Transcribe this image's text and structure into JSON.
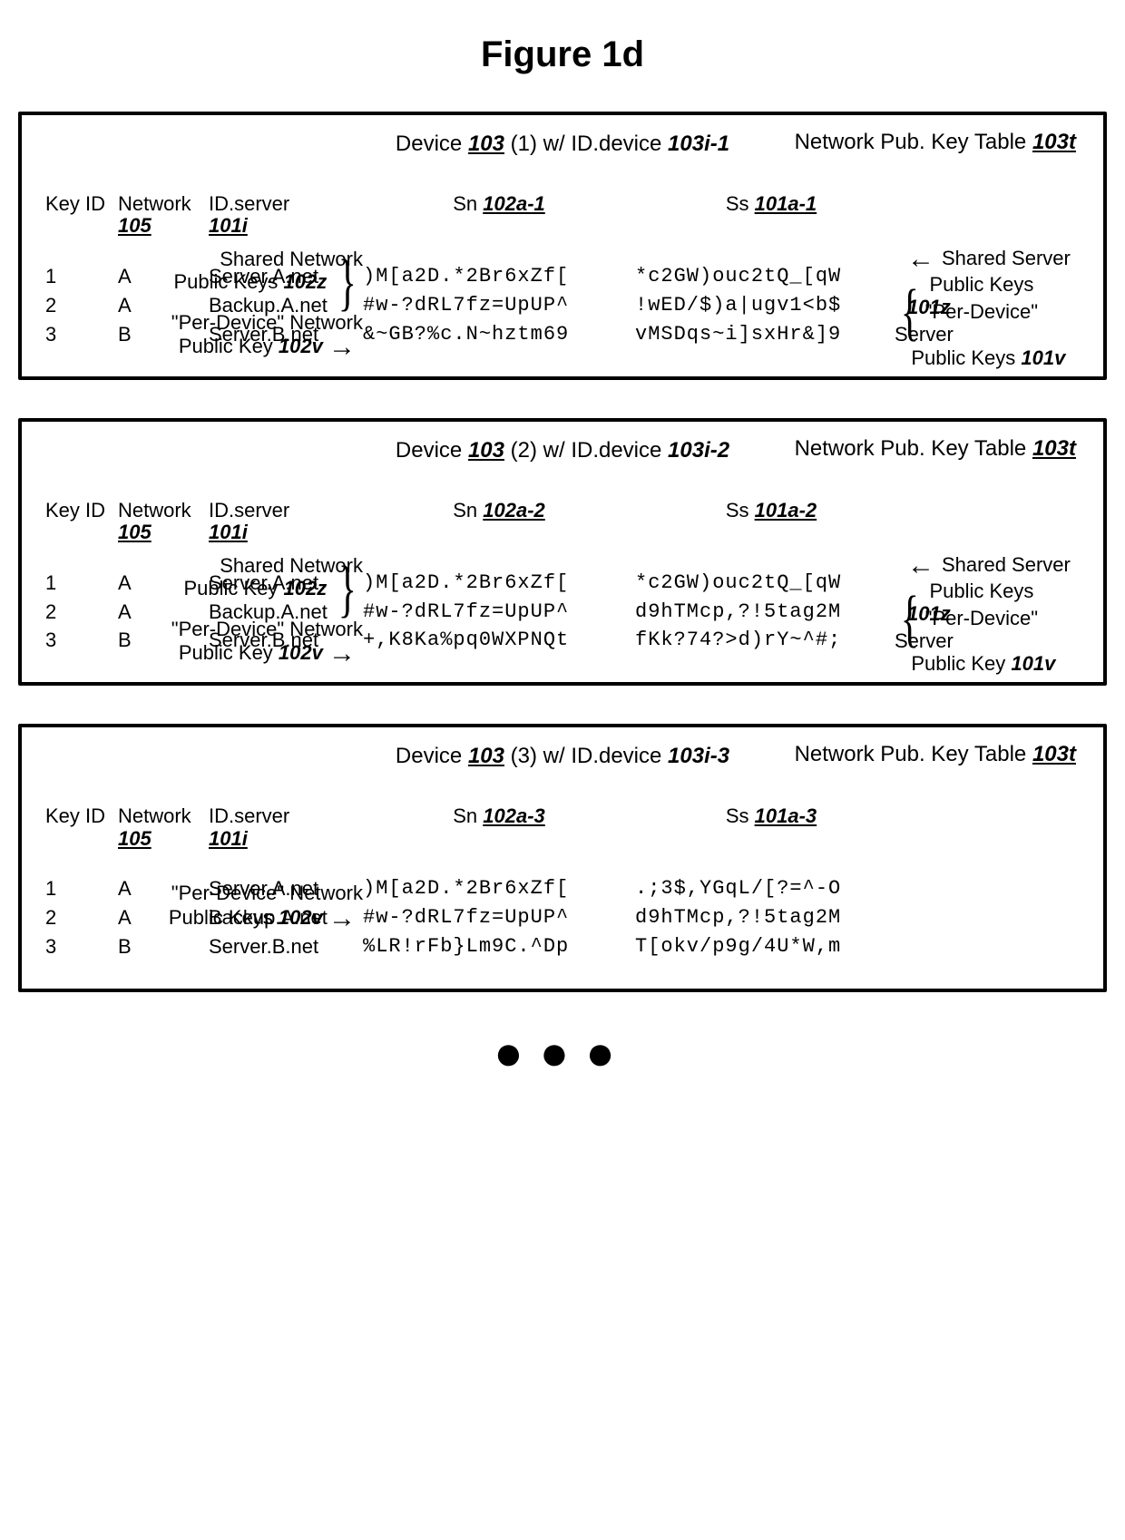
{
  "title": "Figure 1d",
  "continuation_glyph": "●●●",
  "labels": {
    "network_pub_key_table": "Network Pub. Key Table",
    "network_pub_key_table_ref": "103t",
    "shared_net_pk": "Shared Network",
    "shared_net_pk_2": "Public Keys",
    "shared_net_pk_2s": "Public Key",
    "shared_net_ref": "102z",
    "per_dev_net": "\"Per-Device\" Network",
    "per_dev_net_2": "Public Key",
    "per_dev_net_2p": "Public Keys",
    "per_dev_net_ref": "102v",
    "shared_srv_pk": "Shared Server",
    "shared_srv_pk_2": "Public Keys",
    "shared_srv_ref": "101z",
    "per_dev_srv": "\"Per-Device\" Server",
    "per_dev_srv_2": "Public Keys",
    "per_dev_srv_2s": "Public Key",
    "per_dev_srv_ref": "101v"
  },
  "headers": {
    "keyid": "Key ID",
    "network": "Network",
    "network_ref": "105",
    "idserver": "ID.server",
    "idserver_ref": "101i",
    "sn_prefix": "Sn",
    "ss_prefix": "Ss"
  },
  "panels": [
    {
      "device_label": "Device",
      "device_ref": "103",
      "device_n": "(1)",
      "with": "w/ ID.device",
      "id_ref": "103i-1",
      "sn_ref": "102a-1",
      "ss_ref": "101a-1",
      "annot_style": "brace_top_arrow_bottom",
      "rows": [
        {
          "k": "1",
          "n": "A",
          "srv": "Server.A.net",
          "sn": ")M[a2D.*2Br6xZf[",
          "ss": "*c2GW)ouc2tQ_[qW"
        },
        {
          "k": "2",
          "n": "A",
          "srv": "Backup.A.net",
          "sn": "#w-?dRL7fz=UpUP^",
          "ss": "!wED/$)a|ugv1<b$"
        },
        {
          "k": "3",
          "n": "B",
          "srv": "Server.B.net",
          "sn": "&~GB?%c.N~hztm69",
          "ss": "vMSDqs~i]sxHr&]9"
        }
      ]
    },
    {
      "device_label": "Device",
      "device_ref": "103",
      "device_n": "(2)",
      "with": "w/ ID.device",
      "id_ref": "103i-2",
      "sn_ref": "102a-2",
      "ss_ref": "101a-2",
      "annot_style": "brace_top_arrow_bottom",
      "rows": [
        {
          "k": "1",
          "n": "A",
          "srv": "Server.A.net",
          "sn": ")M[a2D.*2Br6xZf[",
          "ss": "*c2GW)ouc2tQ_[qW"
        },
        {
          "k": "2",
          "n": "A",
          "srv": "Backup.A.net",
          "sn": "#w-?dRL7fz=UpUP^",
          "ss": "d9hTMcp,?!5tag2M"
        },
        {
          "k": "3",
          "n": "B",
          "srv": "Server.B.net",
          "sn": "+,K8Ka%pq0WXPNQt",
          "ss": "fKk?74?>d)rY~^#;"
        }
      ]
    },
    {
      "device_label": "Device",
      "device_ref": "103",
      "device_n": "(3)",
      "with": "w/ ID.device",
      "id_ref": "103i-3",
      "sn_ref": "102a-3",
      "ss_ref": "101a-3",
      "annot_style": "arrow_only",
      "rows": [
        {
          "k": "1",
          "n": "A",
          "srv": "Server.A.net",
          "sn": ")M[a2D.*2Br6xZf[",
          "ss": ".;3$,YGqL/[?=^-O"
        },
        {
          "k": "2",
          "n": "A",
          "srv": "Backup.A.net",
          "sn": "#w-?dRL7fz=UpUP^",
          "ss": "d9hTMcp,?!5tag2M"
        },
        {
          "k": "3",
          "n": "B",
          "srv": "Server.B.net",
          "sn": "%LR!rFb}Lm9C.^Dp",
          "ss": "T[okv/p9g/4U*W,m"
        }
      ]
    }
  ]
}
